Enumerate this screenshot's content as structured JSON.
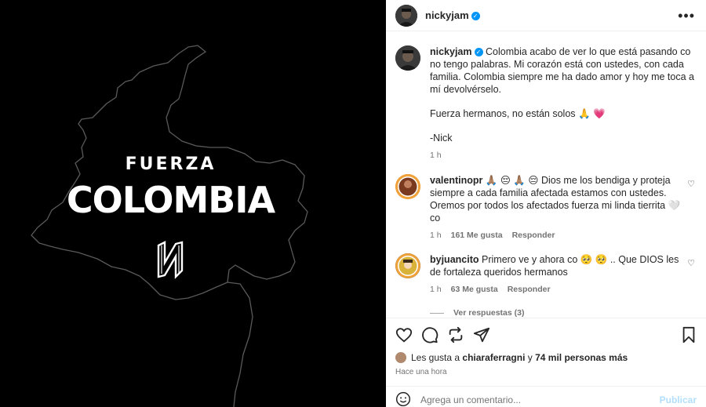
{
  "media": {
    "line1": "FUERZA",
    "line2": "COLOMBIA"
  },
  "header": {
    "username": "nickyjam",
    "verified_glyph": "✓"
  },
  "caption": {
    "username": "nickyjam",
    "paragraph1": "Colombia acabo de ver lo que está pasando co no tengo palabras. Mi corazón está con ustedes, con cada familia. Colombia siempre me ha dado amor y hoy me toca a mí devolvérselo.",
    "paragraph2": "Fuerza hermanos, no están solos 🙏 💗",
    "signature": "-Nick",
    "time": "1 h"
  },
  "comments": [
    {
      "username": "valentinopr",
      "text": "🙏🏽 😔 🙏🏽 😔  Dios me los bendiga y proteja siempre a cada familia afectada estamos con ustedes. Oremos por todos los afectados fuerza mi linda tierrita 🤍 co",
      "time": "1 h",
      "likes": "161 Me gusta",
      "reply": "Responder",
      "avatar_color": "#7a3a1f"
    },
    {
      "username": "byjuancito",
      "text": "Primero ve y ahora co 🥺 🥺 .. Que DIOS les de fortaleza queridos hermanos",
      "time": "1 h",
      "likes": "63 Me gusta",
      "reply": "Responder",
      "avatar_color": "#d9b23a"
    }
  ],
  "view_replies": "Ver respuestas (3)",
  "likes": {
    "prefix": "Les gusta a",
    "user": "chiaraferragni",
    "middle": "y",
    "count": "74 mil personas más"
  },
  "posted": "Hace una hora",
  "comment_box": {
    "placeholder": "Agrega un comentario...",
    "publish": "Publicar"
  },
  "colors": {
    "link_blue": "#0095f6",
    "publish_disabled": "#b2dffc"
  }
}
